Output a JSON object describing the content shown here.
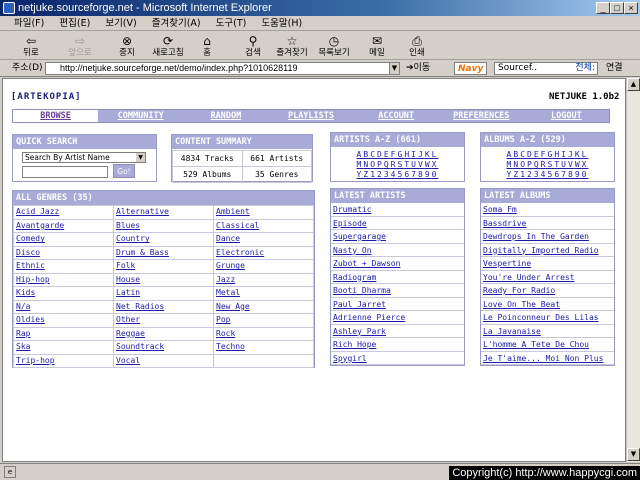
{
  "window": {
    "title": "netjuke.sourceforge.net - Microsoft Internet Explorer"
  },
  "menu": [
    "파일(F)",
    "편집(E)",
    "보기(V)",
    "즐겨찾기(A)",
    "도구(T)",
    "도움말(H)"
  ],
  "toolbar": {
    "back": "뒤로",
    "forward": "앞으로",
    "stop": "중지",
    "refresh": "새로고침",
    "home": "홈",
    "search": "검색",
    "favorites": "즐겨찾기",
    "history": "목록보기",
    "mail": "메일",
    "print": "인쇄"
  },
  "address": {
    "label": "주소(D)",
    "url": "http://netjuke.sourceforge.net/demo/index.php?1010628119",
    "go": "이동",
    "navy": "Navy",
    "search_value": "Sourcef..",
    "all": "전체:",
    "links": "연결"
  },
  "page": {
    "logo": "[ARTEKOPIA]",
    "version": "NETJUKE 1.0b2",
    "nav": [
      "BROWSE",
      "COMMUNITY",
      "RANDOM",
      "PLAYLISTS",
      "ACCOUNT",
      "PREFERENCES",
      "LOGOUT"
    ],
    "quick_search": {
      "title": "QUICK SEARCH",
      "select": "Search By Artist Name",
      "go": "Go!"
    },
    "summary": {
      "title": "CONTENT SUMMARY",
      "tracks": "4834 Tracks",
      "artists": "661 Artists",
      "albums": "529 Albums",
      "genres": "35 Genres"
    },
    "artists_az": {
      "title": "ARTISTS A-Z (661)"
    },
    "albums_az": {
      "title": "ALBUMS A-Z (529)"
    },
    "az_rows": [
      [
        "A",
        "B",
        "C",
        "D",
        "E",
        "F",
        "G",
        "H",
        "I",
        "J",
        "K",
        "L"
      ],
      [
        "M",
        "N",
        "O",
        "P",
        "Q",
        "R",
        "S",
        "T",
        "U",
        "V",
        "W",
        "X"
      ],
      [
        "Y",
        "Z",
        "1",
        "2",
        "3",
        "4",
        "5",
        "6",
        "7",
        "8",
        "9",
        "0"
      ]
    ],
    "genres": {
      "title": "ALL GENRES (35)",
      "rows": [
        [
          "Acid Jazz",
          "Alternative",
          "Ambient"
        ],
        [
          "Avantgarde",
          "Blues",
          "Classical"
        ],
        [
          "Comedy",
          "Country",
          "Dance"
        ],
        [
          "Disco",
          "Drum & Bass",
          "Electronic"
        ],
        [
          "Ethnic",
          "Folk",
          "Grunge"
        ],
        [
          "Hip-hop",
          "House",
          "Jazz"
        ],
        [
          "Kids",
          "Latin",
          "Metal"
        ],
        [
          "N/a",
          "Net Radios",
          "New Age"
        ],
        [
          "Oldies",
          "Other",
          "Pop"
        ],
        [
          "Rap",
          "Reggae",
          "Rock"
        ],
        [
          "Ska",
          "Soundtrack",
          "Techno"
        ],
        [
          "Trip-hop",
          "Vocal",
          ""
        ]
      ]
    },
    "latest_artists": {
      "title": "LATEST ARTISTS",
      "items": [
        "Drumatic",
        "Episode",
        "Supergarage",
        "Nasty On",
        "Zubot + Dawson",
        "Radiogram",
        "Booti Dharma",
        "Paul Jarret",
        "Adrienne Pierce",
        "Ashley Park",
        "Rich Hope",
        "Spygirl"
      ]
    },
    "latest_albums": {
      "title": "LATEST ALBUMS",
      "items": [
        "Soma Fm",
        "Bassdrive",
        "Dewdrops In The Garden",
        "Digitally Imported Radio",
        "Vespertine",
        "You're Under Arrest",
        "Ready For Radio",
        "Love On The Beat",
        "Le Poinconneur Des Lilas",
        "La Javanaise",
        "L'homme A Tete De Chou",
        "Je T'aime... Moi Non Plus"
      ]
    }
  },
  "statusbar": {
    "copyright": "Copyright(c) http://www.happycgi.com"
  }
}
